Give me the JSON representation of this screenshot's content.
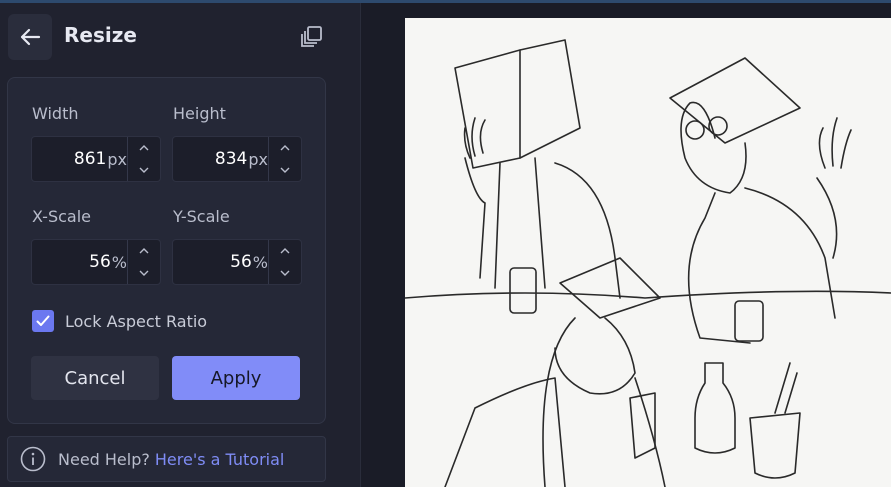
{
  "panel": {
    "title": "Resize",
    "back_icon": "arrow-left-icon",
    "duplicate_icon": "duplicate-icon"
  },
  "fields": {
    "width": {
      "label": "Width",
      "value": "861",
      "unit": "px"
    },
    "height": {
      "label": "Height",
      "value": "834",
      "unit": "px"
    },
    "x_scale": {
      "label": "X-Scale",
      "value": "56",
      "unit": "%"
    },
    "y_scale": {
      "label": "Y-Scale",
      "value": "56",
      "unit": "%"
    }
  },
  "lock_aspect": {
    "label": "Lock Aspect Ratio",
    "checked": true
  },
  "buttons": {
    "cancel": "Cancel",
    "apply": "Apply"
  },
  "help": {
    "prefix": "Need Help?",
    "link": "Here's a Tutorial",
    "icon": "info-icon"
  },
  "colors": {
    "accent": "#818cf8",
    "panel": "#20222f",
    "card": "#252837",
    "link": "#7f8cf5"
  }
}
